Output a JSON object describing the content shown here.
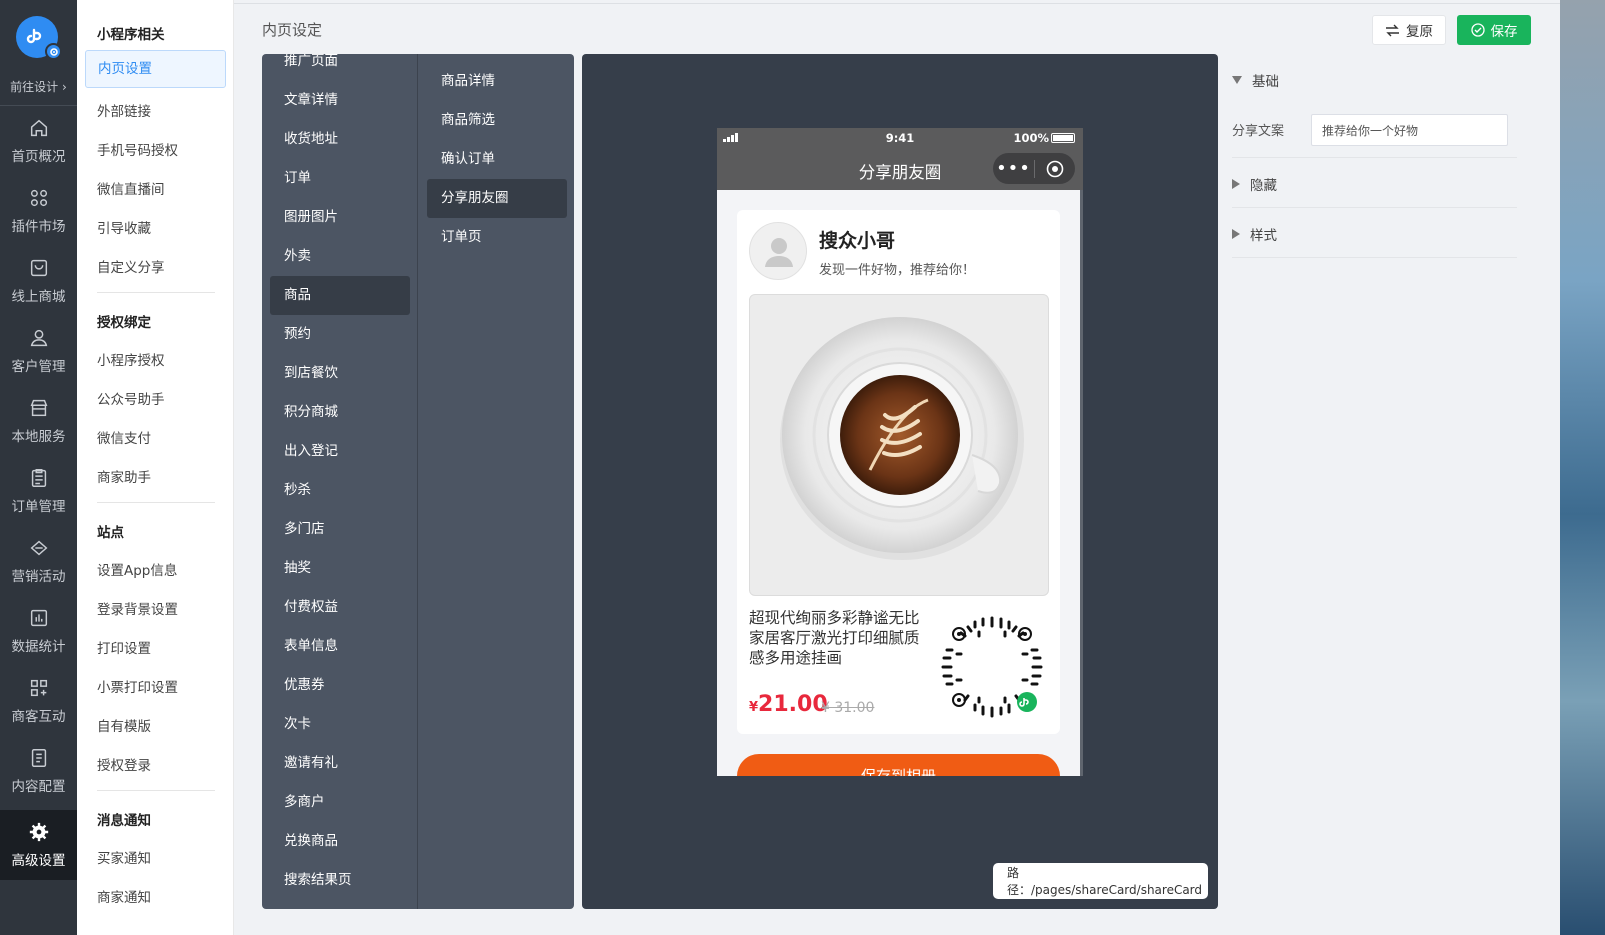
{
  "nav": {
    "goto_design": "前往设计",
    "items": [
      {
        "label": "首页概况",
        "icon": "home-icon"
      },
      {
        "label": "插件市场",
        "icon": "plugin-icon"
      },
      {
        "label": "线上商城",
        "icon": "shop-bag-icon"
      },
      {
        "label": "客户管理",
        "icon": "user-icon"
      },
      {
        "label": "本地服务",
        "icon": "store-icon"
      },
      {
        "label": "订单管理",
        "icon": "clipboard-icon"
      },
      {
        "label": "营销活动",
        "icon": "diamond-icon"
      },
      {
        "label": "数据统计",
        "icon": "chart-icon"
      },
      {
        "label": "商客互动",
        "icon": "interact-icon"
      },
      {
        "label": "内容配置",
        "icon": "document-icon"
      },
      {
        "label": "高级设置",
        "icon": "gear-icon"
      }
    ]
  },
  "menu": {
    "group1": "小程序相关",
    "group1_items": [
      "内页设置",
      "外部链接",
      "手机号码授权",
      "微信直播间",
      "引导收藏",
      "自定义分享"
    ],
    "group2": "授权绑定",
    "group2_items": [
      "小程序授权",
      "公众号助手",
      "微信支付",
      "商家助手"
    ],
    "group3": "站点",
    "group3_items": [
      "设置App信息",
      "登录背景设置",
      "打印设置",
      "小票打印设置",
      "自有模版",
      "授权登录"
    ],
    "group4": "消息通知",
    "group4_items": [
      "买家通知",
      "商家通知"
    ]
  },
  "header": {
    "title": "内页设定",
    "reset": "复原",
    "save": "保存"
  },
  "pages": {
    "col1": [
      "推广页面",
      "文章详情",
      "收货地址",
      "订单",
      "图册图片",
      "外卖",
      "商品",
      "预约",
      "到店餐饮",
      "积分商城",
      "出入登记",
      "秒杀",
      "多门店",
      "抽奖",
      "付费权益",
      "表单信息",
      "优惠券",
      "次卡",
      "邀请有礼",
      "多商户",
      "兑换商品",
      "搜索结果页"
    ],
    "col1_active": "商品",
    "col2": [
      "商品详情",
      "商品筛选",
      "确认订单",
      "分享朋友圈",
      "订单页"
    ],
    "col2_active": "分享朋友圈"
  },
  "phone": {
    "time": "9:41",
    "battery": "100%",
    "nav_title": "分享朋友圈",
    "capsule_dots": "•••",
    "nickname": "搜众小哥",
    "slogan": "发现一件好物，推荐给你！",
    "product_name": "超现代绚丽多彩静谧无比家居客厅激光打印细腻质感多用途挂画",
    "currency": "¥",
    "price": "21.00",
    "orig_price": "¥ 31.00",
    "save_button": "保存到相册"
  },
  "path": "路径：/pages/shareCard/shareCard",
  "props": {
    "basic": "基础",
    "share_label": "分享文案",
    "share_value": "推荐给你一个好物",
    "hide": "隐藏",
    "style": "样式"
  },
  "colors": {
    "accent": "#2f8cf2",
    "save_green": "#19b45c",
    "price_red": "#e8283c",
    "button_orange": "#f05c14",
    "nav_dark": "#2f353d"
  }
}
